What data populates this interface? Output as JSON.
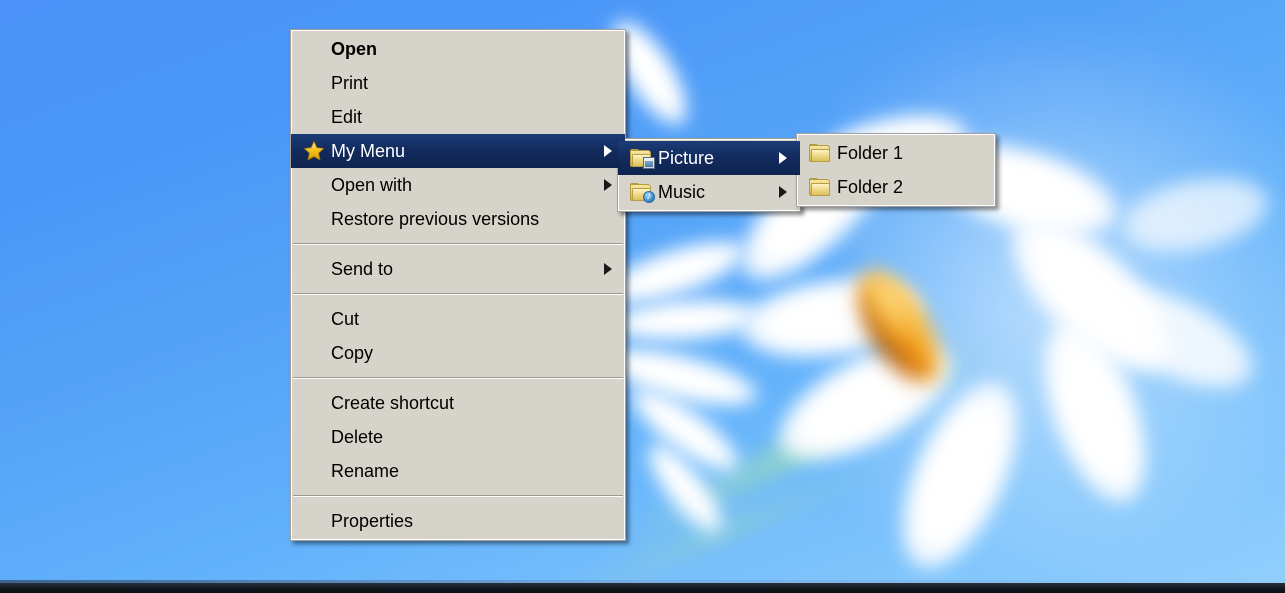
{
  "desktop": {
    "wallpaper_name": "blurred-daisy-wallpaper",
    "background_top_color": "#4a92f7",
    "background_bottom_color": "#93cffd",
    "taskbar_color": "#12161d"
  },
  "context_menu": {
    "name": "file-context-menu",
    "background_color": "#d6d3ca",
    "highlight_color": "#1d3c78",
    "text_color": "#000000",
    "groups": [
      {
        "items": [
          {
            "label": "Open",
            "bold": true,
            "icon": null,
            "has_submenu": false,
            "highlighted": false
          },
          {
            "label": "Print",
            "bold": false,
            "icon": null,
            "has_submenu": false,
            "highlighted": false
          },
          {
            "label": "Edit",
            "bold": false,
            "icon": null,
            "has_submenu": false,
            "highlighted": false
          },
          {
            "label": "My Menu",
            "bold": false,
            "icon": "star-icon",
            "has_submenu": true,
            "highlighted": true
          },
          {
            "label": "Open with",
            "bold": false,
            "icon": null,
            "has_submenu": true,
            "highlighted": false
          },
          {
            "label": "Restore previous versions",
            "bold": false,
            "icon": null,
            "has_submenu": false,
            "highlighted": false
          }
        ]
      },
      {
        "items": [
          {
            "label": "Send to",
            "bold": false,
            "icon": null,
            "has_submenu": true,
            "highlighted": false
          }
        ]
      },
      {
        "items": [
          {
            "label": "Cut",
            "bold": false,
            "icon": null,
            "has_submenu": false,
            "highlighted": false
          },
          {
            "label": "Copy",
            "bold": false,
            "icon": null,
            "has_submenu": false,
            "highlighted": false
          }
        ]
      },
      {
        "items": [
          {
            "label": "Create shortcut",
            "bold": false,
            "icon": null,
            "has_submenu": false,
            "highlighted": false
          },
          {
            "label": "Delete",
            "bold": false,
            "icon": null,
            "has_submenu": false,
            "highlighted": false
          },
          {
            "label": "Rename",
            "bold": false,
            "icon": null,
            "has_submenu": false,
            "highlighted": false
          }
        ]
      },
      {
        "items": [
          {
            "label": "Properties",
            "bold": false,
            "icon": null,
            "has_submenu": false,
            "highlighted": false
          }
        ]
      }
    ]
  },
  "submenu_level_1": {
    "name": "my-menu-submenu",
    "items": [
      {
        "label": "Picture",
        "icon": "picture-folder-icon",
        "has_submenu": true,
        "highlighted": true
      },
      {
        "label": "Music",
        "icon": "music-folder-icon",
        "has_submenu": true,
        "highlighted": false
      }
    ]
  },
  "submenu_level_2": {
    "name": "picture-submenu",
    "items": [
      {
        "label": "Folder 1",
        "icon": "folder-icon",
        "has_submenu": false,
        "highlighted": false
      },
      {
        "label": "Folder 2",
        "icon": "folder-icon",
        "has_submenu": false,
        "highlighted": false
      }
    ]
  }
}
